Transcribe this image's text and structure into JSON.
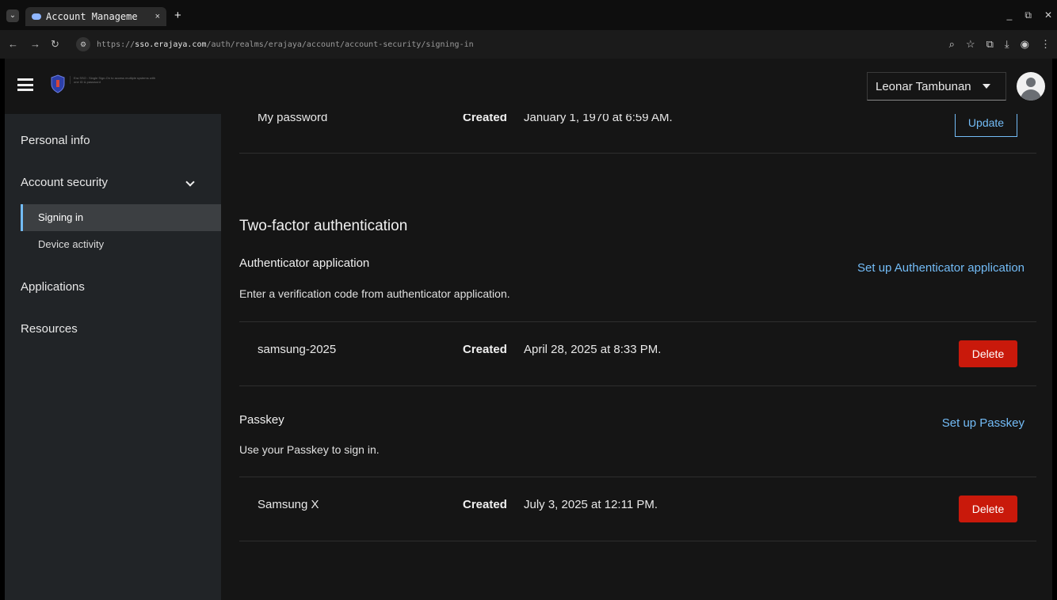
{
  "browser": {
    "tab_title": "Account Manageme",
    "tab_close": "×",
    "new_tab": "+",
    "url_prefix": "https://",
    "url_host": "sso.erajaya.com",
    "url_path": "/auth/realms/erajaya/account/account-security/signing-in"
  },
  "header": {
    "logo_text": "Era SSO : Single Sign-On to access multiple systems with one ID & password",
    "user_name": "Leonar Tambunan"
  },
  "sidebar": {
    "items": [
      {
        "label": "Personal info"
      },
      {
        "label": "Account security"
      },
      {
        "label": "Applications"
      },
      {
        "label": "Resources"
      }
    ],
    "sub_items": [
      {
        "label": "Signing in",
        "active": true
      },
      {
        "label": "Device activity",
        "active": false
      }
    ]
  },
  "main": {
    "password_row": {
      "name": "My password",
      "created_label": "Created",
      "date": "January 1, 1970 at 6:59 AM.",
      "button": "Update"
    },
    "two_factor": {
      "title": "Two-factor authentication",
      "authenticator": {
        "title": "Authenticator application",
        "setup_link": "Set up Authenticator application",
        "description": "Enter a verification code from authenticator application.",
        "row": {
          "name": "samsung-2025",
          "created_label": "Created",
          "date": "April 28, 2025 at 8:33 PM.",
          "button": "Delete"
        }
      },
      "passkey": {
        "title": "Passkey",
        "setup_link": "Set up Passkey",
        "description": "Use your Passkey to sign in.",
        "row": {
          "name": "Samsung X",
          "created_label": "Created",
          "date": "July 3, 2025 at 12:11 PM.",
          "button": "Delete"
        }
      }
    }
  },
  "colors": {
    "accent": "#73bcf7",
    "danger": "#c9190b",
    "sidebar_bg": "#212427",
    "main_bg": "#151515"
  }
}
